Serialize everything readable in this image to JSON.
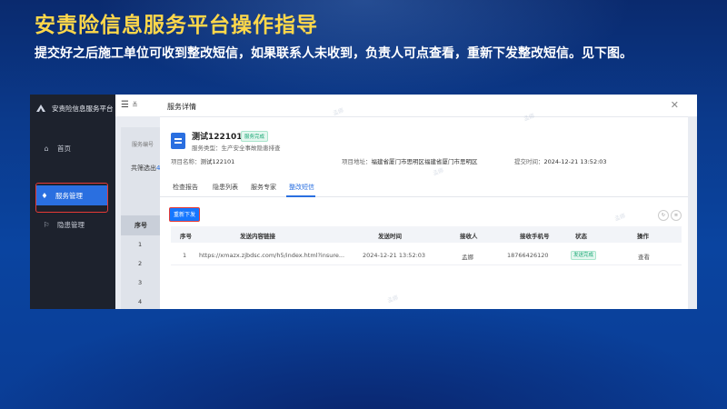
{
  "slide": {
    "title": "安责险信息服务平台操作指导",
    "description": "提交好之后施工单位可收到整改短信，如果联系人未收到，负责人可点查看，重新下发整改短信。见下图。"
  },
  "sidebar": {
    "brand": "安责险信息服务平台",
    "items": [
      {
        "icon": "home-icon",
        "label": "首页"
      },
      {
        "icon": "service-icon",
        "label": "服务管理"
      },
      {
        "icon": "hazard-icon",
        "label": "隐患管理"
      }
    ]
  },
  "background": {
    "filter_label": "服务编号",
    "total_text": "共筛选出",
    "total_count": "4",
    "table_header": "序号",
    "row_numbers": [
      "1",
      "2",
      "3",
      "4"
    ]
  },
  "modal": {
    "title": "服务详情",
    "service_name": "测试122101",
    "status": "服务完成",
    "service_type_label": "服务类型：",
    "service_type": "生产安全事故隐患排查",
    "project_name_label": "项目名称：",
    "project_name": "测试122101",
    "project_address_label": "项目地址：",
    "project_address": "福建省厦门市思明区福建省厦门市思明区",
    "submit_time_label": "提交时间：",
    "submit_time": "2024-12-21 13:52:03",
    "tabs": [
      "检查报告",
      "隐患列表",
      "服务专家",
      "整改短信"
    ],
    "active_tab": "整改短信",
    "resend_button": "重新下发",
    "table": {
      "headers": [
        "序号",
        "发送内容链接",
        "发送时间",
        "接收人",
        "接收手机号",
        "状态",
        "操作"
      ],
      "rows": [
        {
          "index": "1",
          "link": "https://xmazx.zjbdsc.com/h5/index.html?insure...",
          "time": "2024-12-21 13:52:03",
          "receiver": "孟娜",
          "phone": "18766426120",
          "status": "发送完成",
          "action": "查看"
        }
      ]
    }
  },
  "colors": {
    "title": "#ffd84a",
    "accent": "#1677ff",
    "highlight_box": "#e53935",
    "success": "#17a673"
  }
}
